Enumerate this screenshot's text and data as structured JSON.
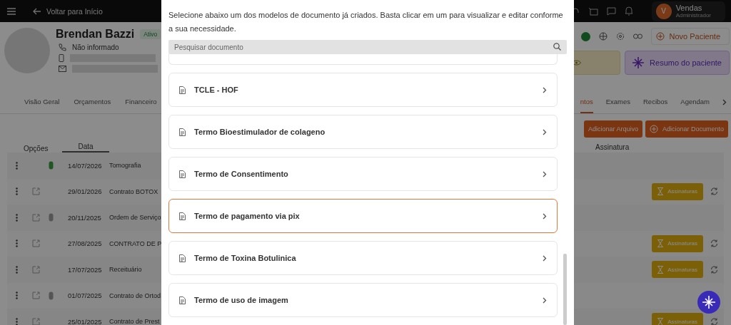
{
  "topbar": {
    "back_label": "Voltar para Início",
    "user": {
      "initial": "V",
      "name": "Vendas",
      "role": "Administrador"
    }
  },
  "patient": {
    "name": "Brendan Bazzi",
    "status": "Ativo",
    "phone": "Não informado"
  },
  "new_patient_button": "Novo Paciente",
  "summary_button": "Resumo do paciente",
  "tabs": [
    {
      "label": "Visão Geral",
      "selected": false
    },
    {
      "label": "Orçamentos",
      "selected": false
    },
    {
      "label": "Financeiro",
      "selected": false
    },
    {
      "label": "ntos",
      "selected": true
    },
    {
      "label": "Exames",
      "selected": false
    },
    {
      "label": "Recibos",
      "selected": false
    },
    {
      "label": "Agendam",
      "selected": false
    }
  ],
  "actions": [
    "Adicionar Arquivo",
    "Adicionar Documento"
  ],
  "table": {
    "columns": [
      "Opções",
      "Data",
      "Assinatura"
    ],
    "rows": [
      {
        "date": "14/07/2026",
        "name": "Tomografia",
        "editable": false,
        "attachment": true,
        "color": "#215521",
        "signature": null
      },
      {
        "date": "29/01/2026",
        "name": "Contrato BOTOX",
        "editable": true,
        "attachment": false,
        "signature": "Assinaturas"
      },
      {
        "date": "20/11/2025",
        "name": "Ordem de Serviço",
        "editable": true,
        "attachment": true,
        "color": "#555555",
        "signature": null
      },
      {
        "date": "27/08/2025",
        "name": "CONTRATO DE P",
        "editable": true,
        "attachment": false,
        "signature": "Assinaturas"
      },
      {
        "date": "17/07/2025",
        "name": "Receituário",
        "editable": true,
        "attachment": false,
        "signature": "Assinaturas"
      },
      {
        "date": "01/07/2025",
        "name": "Contrato de Ortod",
        "editable": true,
        "attachment": true,
        "color": "#555555",
        "signature": null
      },
      {
        "date": "25/01/2025",
        "name": "Contrato de Prest",
        "editable": true,
        "attachment": false,
        "signature": "Assinaturas"
      }
    ]
  },
  "modal": {
    "description": "Selecione abaixo um dos modelos de documento já criados. Basta clicar em um para visualizar e editar conforme a sua necessidade.",
    "search": {
      "placeholder": "Pesquisar documento"
    },
    "documents": [
      {
        "title": "TCLE - HOF",
        "selected": false
      },
      {
        "title": "Termo Bioestimulador de colageno",
        "selected": false
      },
      {
        "title": "Termo de Consentimento",
        "selected": false
      },
      {
        "title": "Termo de pagamento via pix",
        "selected": true
      },
      {
        "title": "Termo de Toxina Botulinica",
        "selected": false
      },
      {
        "title": "Termo de uso de imagem",
        "selected": false
      }
    ]
  }
}
